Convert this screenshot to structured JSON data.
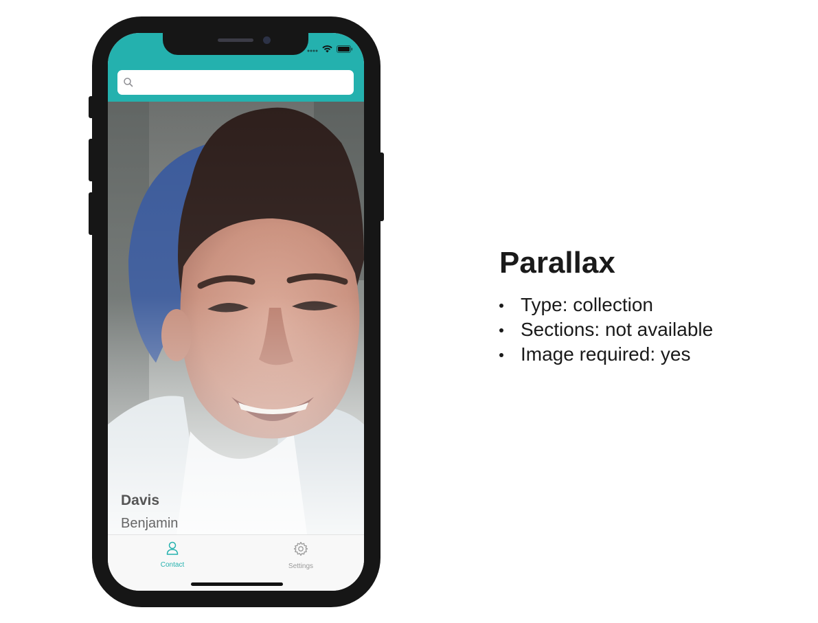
{
  "header": {
    "search_placeholder": "",
    "accent_color": "#24b1ae"
  },
  "card": {
    "last_name": "Davis",
    "first_name": "Benjamin"
  },
  "tabs": [
    {
      "label": "Contact",
      "icon": "person-icon",
      "active": true,
      "color": "#24b1ae"
    },
    {
      "label": "Settings",
      "icon": "gear-icon",
      "active": false,
      "color": "#9a9a9a"
    }
  ],
  "info": {
    "title": "Parallax",
    "items": [
      "Type: collection",
      "Sections: not available",
      "Image required: yes"
    ]
  }
}
